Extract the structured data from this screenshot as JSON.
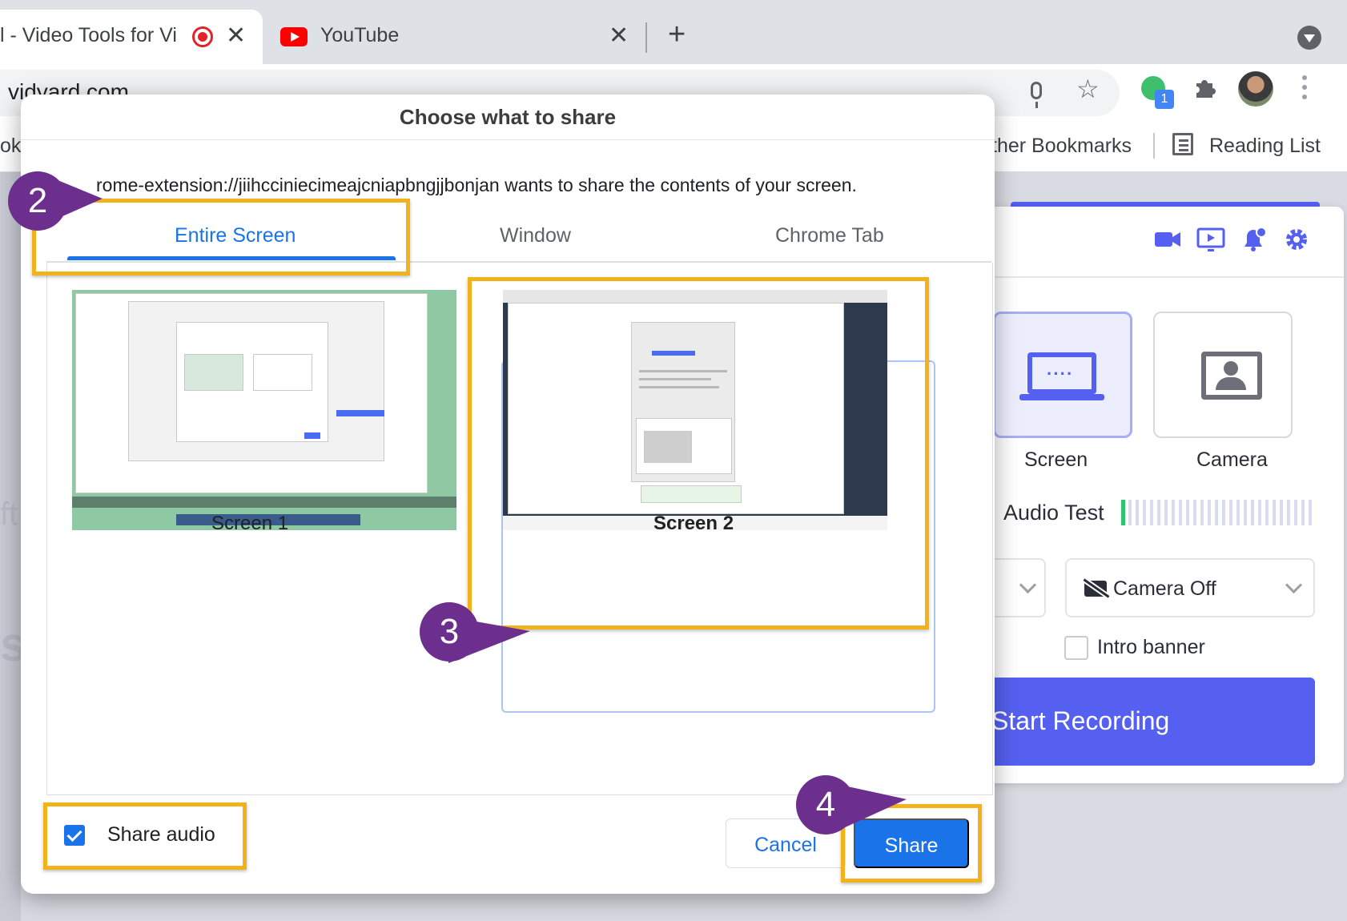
{
  "browser": {
    "tabs": [
      {
        "title": "l - Video Tools for Vi",
        "close": "✕"
      },
      {
        "title": "YouTube",
        "close": "✕"
      }
    ],
    "new_tab": "+",
    "url": "vidyard.com",
    "extension_badge": "1",
    "bookmarks_left": "ok",
    "other_bookmarks": "ther Bookmarks",
    "reading_list": "Reading List"
  },
  "vidyard": {
    "sources": [
      "Screen",
      "Camera"
    ],
    "audio_test": "Audio Test",
    "camera_select": "Camera Off",
    "intro_banner": "Intro banner",
    "start_recording": "Start Recording",
    "accent": "#5560f0"
  },
  "dialog": {
    "title": "Choose what to share",
    "message": "rome-extension://jiihcciniecimeajcniapbngjjbonjan wants to share the contents of your screen.",
    "tabs": [
      "Entire Screen",
      "Window",
      "Chrome Tab"
    ],
    "active_tab": "Entire Screen",
    "screens": [
      "Screen 1",
      "Screen 2"
    ],
    "selected_screen": "Screen 2",
    "share_audio": "Share audio",
    "share_audio_checked": true,
    "cancel": "Cancel",
    "share": "Share"
  },
  "annotations": {
    "steps": [
      "2",
      "3",
      "4"
    ],
    "highlight_color": "#f2b21b",
    "callout_color": "#6d2f8e"
  }
}
